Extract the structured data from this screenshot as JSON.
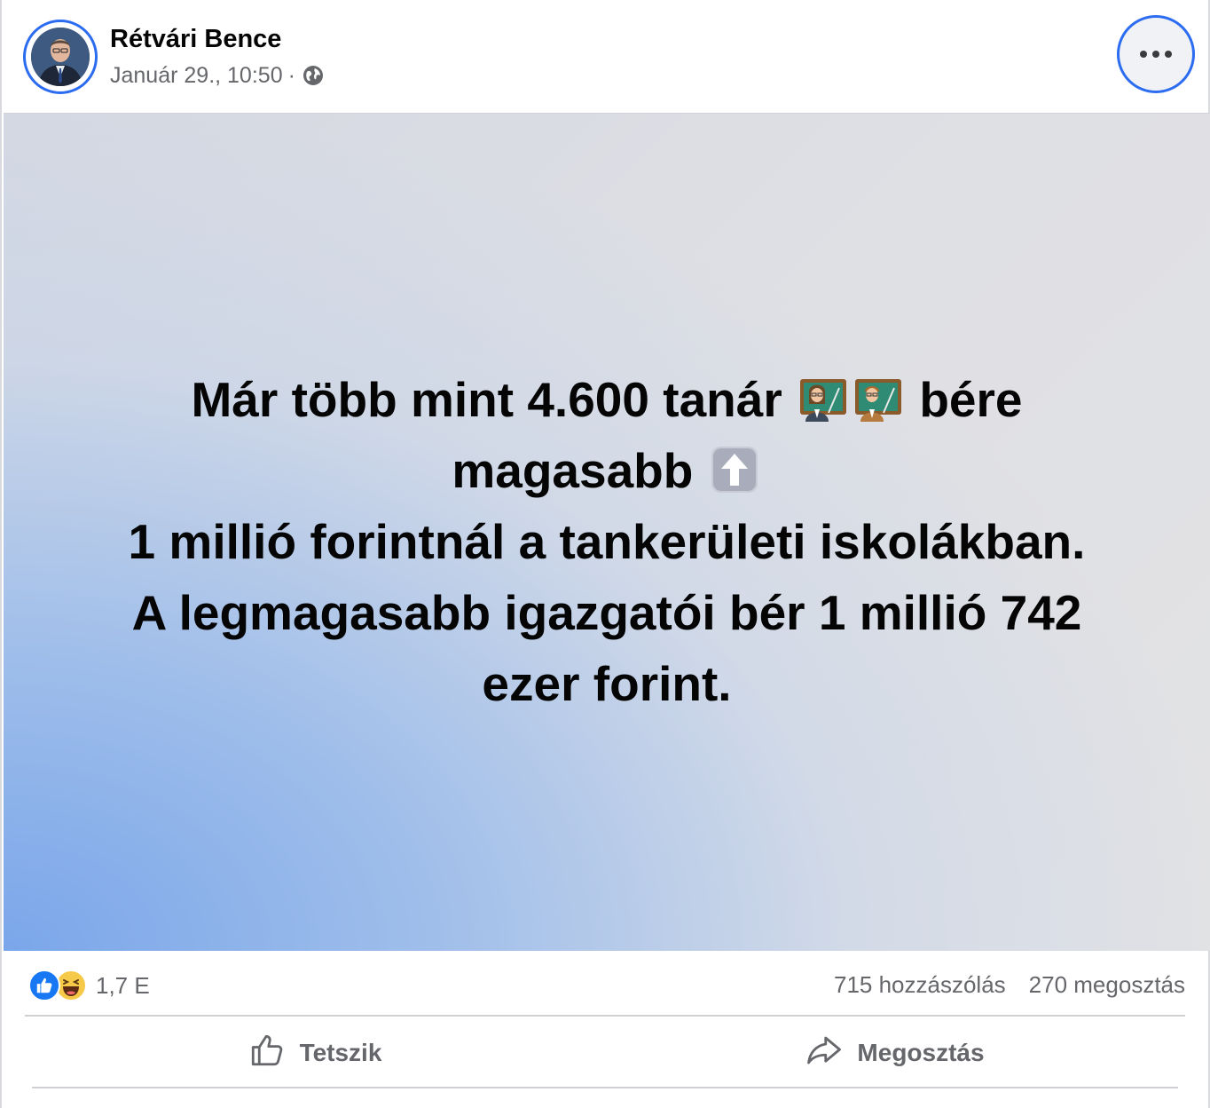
{
  "post": {
    "author": "Rétvári Bence",
    "timestamp": "Január 29., 10:50",
    "separator": "·",
    "privacy_icon": "globe-icon",
    "more_icon": "more-options-icon",
    "content": {
      "line1_a": "Már több mint 4.600 tanár",
      "line1_emoji": [
        "woman-teacher-emoji",
        "man-teacher-emoji"
      ],
      "line1_b": "bére",
      "line2_a": "magasabb",
      "line2_emoji": "up-arrow-emoji",
      "line3": "1 millió forintnál a tankerületi iskolákban.",
      "line4": "A legmagasabb igazgatói bér 1 millió 742",
      "line5": "ezer forint."
    },
    "stats": {
      "reaction_icons": [
        "like-reaction-icon",
        "haha-reaction-icon"
      ],
      "reactions_count": "1,7 E",
      "comments": "715 hozzászólás",
      "shares": "270 megosztás"
    },
    "actions": {
      "like_label": "Tetszik",
      "share_label": "Megosztás"
    }
  },
  "colors": {
    "accent_ring": "#2c6cf0",
    "like_blue": "#1877f2",
    "secondary_text": "#65676b",
    "primary_text": "#050505"
  }
}
